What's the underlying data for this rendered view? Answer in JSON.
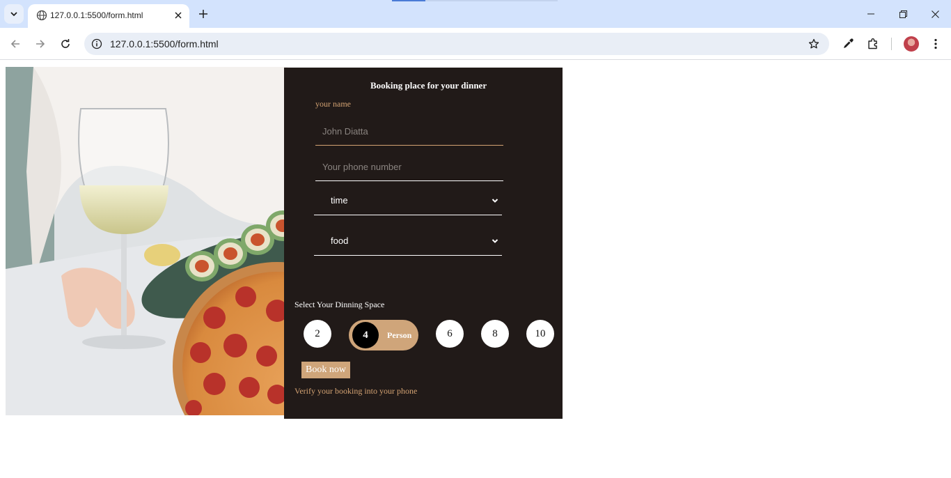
{
  "browser": {
    "tab_title": "127.0.0.1:5500/form.html",
    "url": "127.0.0.1:5500/form.html",
    "icons": [
      "tab-list-icon",
      "globe-icon",
      "close-icon",
      "plus-icon",
      "minimize-icon",
      "restore-icon",
      "close-window-icon",
      "back-icon",
      "forward-icon",
      "reload-icon",
      "site-info-icon",
      "star-icon",
      "eyedropper-icon",
      "extensions-icon",
      "avatar",
      "menu-icon"
    ]
  },
  "form": {
    "title": "Booking place for your dinner",
    "name_label": "your name",
    "name_placeholder": "John Diatta",
    "phone_placeholder": "Your phone number",
    "time_select": "time",
    "food_select": "food",
    "space_label": "Select Your Dinning Space",
    "sizes": [
      "2",
      "4",
      "6",
      "8",
      "10"
    ],
    "selected_size": "4",
    "selected_size_label": "Person",
    "book_button": "Book now",
    "verify_text": "Verify your booking into your phone"
  },
  "colors": {
    "panel_bg": "#211a18",
    "accent": "#d4a373",
    "accent_button": "#cfa57a"
  }
}
